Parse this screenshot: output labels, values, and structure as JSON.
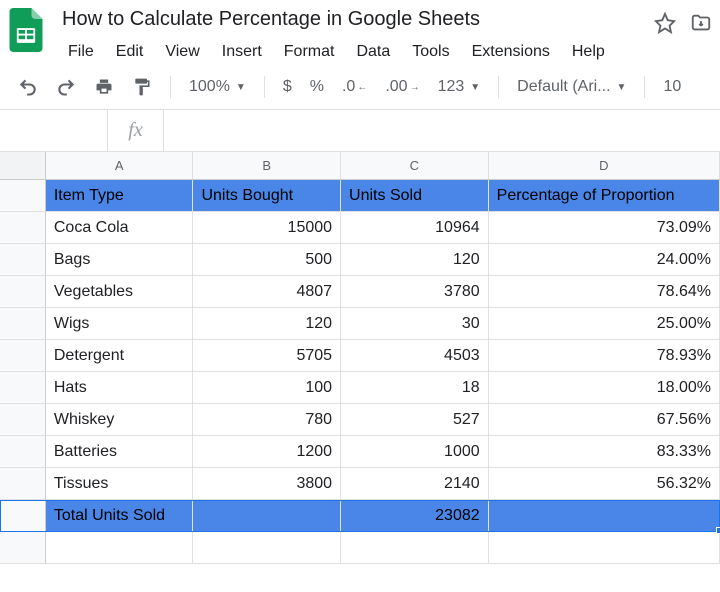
{
  "doc": {
    "title": "How to Calculate Percentage in Google Sheets"
  },
  "menus": [
    "File",
    "Edit",
    "View",
    "Insert",
    "Format",
    "Data",
    "Tools",
    "Extensions",
    "Help"
  ],
  "toolbar": {
    "zoom": "100%",
    "currency": "$",
    "percent": "%",
    "dec_dec": ".0",
    "inc_dec": ".00",
    "numfmt": "123",
    "font": "Default (Ari...",
    "fontsize": "10"
  },
  "fx": {
    "label": "fx"
  },
  "columns": [
    "A",
    "B",
    "C",
    "D"
  ],
  "headers": {
    "item": "Item Type",
    "bought": "Units Bought",
    "sold": "Units Sold",
    "pct": "Percentage of Proportion"
  },
  "rows": [
    {
      "item": "Coca Cola",
      "bought": "15000",
      "sold": "10964",
      "pct": "73.09%"
    },
    {
      "item": "Bags",
      "bought": "500",
      "sold": "120",
      "pct": "24.00%"
    },
    {
      "item": "Vegetables",
      "bought": "4807",
      "sold": "3780",
      "pct": "78.64%"
    },
    {
      "item": "Wigs",
      "bought": "120",
      "sold": "30",
      "pct": "25.00%"
    },
    {
      "item": "Detergent",
      "bought": "5705",
      "sold": "4503",
      "pct": "78.93%"
    },
    {
      "item": "Hats",
      "bought": "100",
      "sold": "18",
      "pct": "18.00%"
    },
    {
      "item": "Whiskey",
      "bought": "780",
      "sold": "527",
      "pct": "67.56%"
    },
    {
      "item": "Batteries",
      "bought": "1200",
      "sold": "1000",
      "pct": "83.33%"
    },
    {
      "item": "Tissues",
      "bought": "3800",
      "sold": "2140",
      "pct": "56.32%"
    }
  ],
  "total": {
    "label": "Total Units Sold",
    "sold": "23082"
  },
  "chart_data": {
    "type": "table",
    "title": "How to Calculate Percentage in Google Sheets",
    "columns": [
      "Item Type",
      "Units Bought",
      "Units Sold",
      "Percentage of Proportion"
    ],
    "data": [
      [
        "Coca Cola",
        15000,
        10964,
        73.09
      ],
      [
        "Bags",
        500,
        120,
        24.0
      ],
      [
        "Vegetables",
        4807,
        3780,
        78.64
      ],
      [
        "Wigs",
        120,
        30,
        25.0
      ],
      [
        "Detergent",
        5705,
        4503,
        78.93
      ],
      [
        "Hats",
        100,
        18,
        18.0
      ],
      [
        "Whiskey",
        780,
        527,
        67.56
      ],
      [
        "Batteries",
        1200,
        1000,
        83.33
      ],
      [
        "Tissues",
        3800,
        2140,
        56.32
      ]
    ],
    "total_units_sold": 23082
  }
}
